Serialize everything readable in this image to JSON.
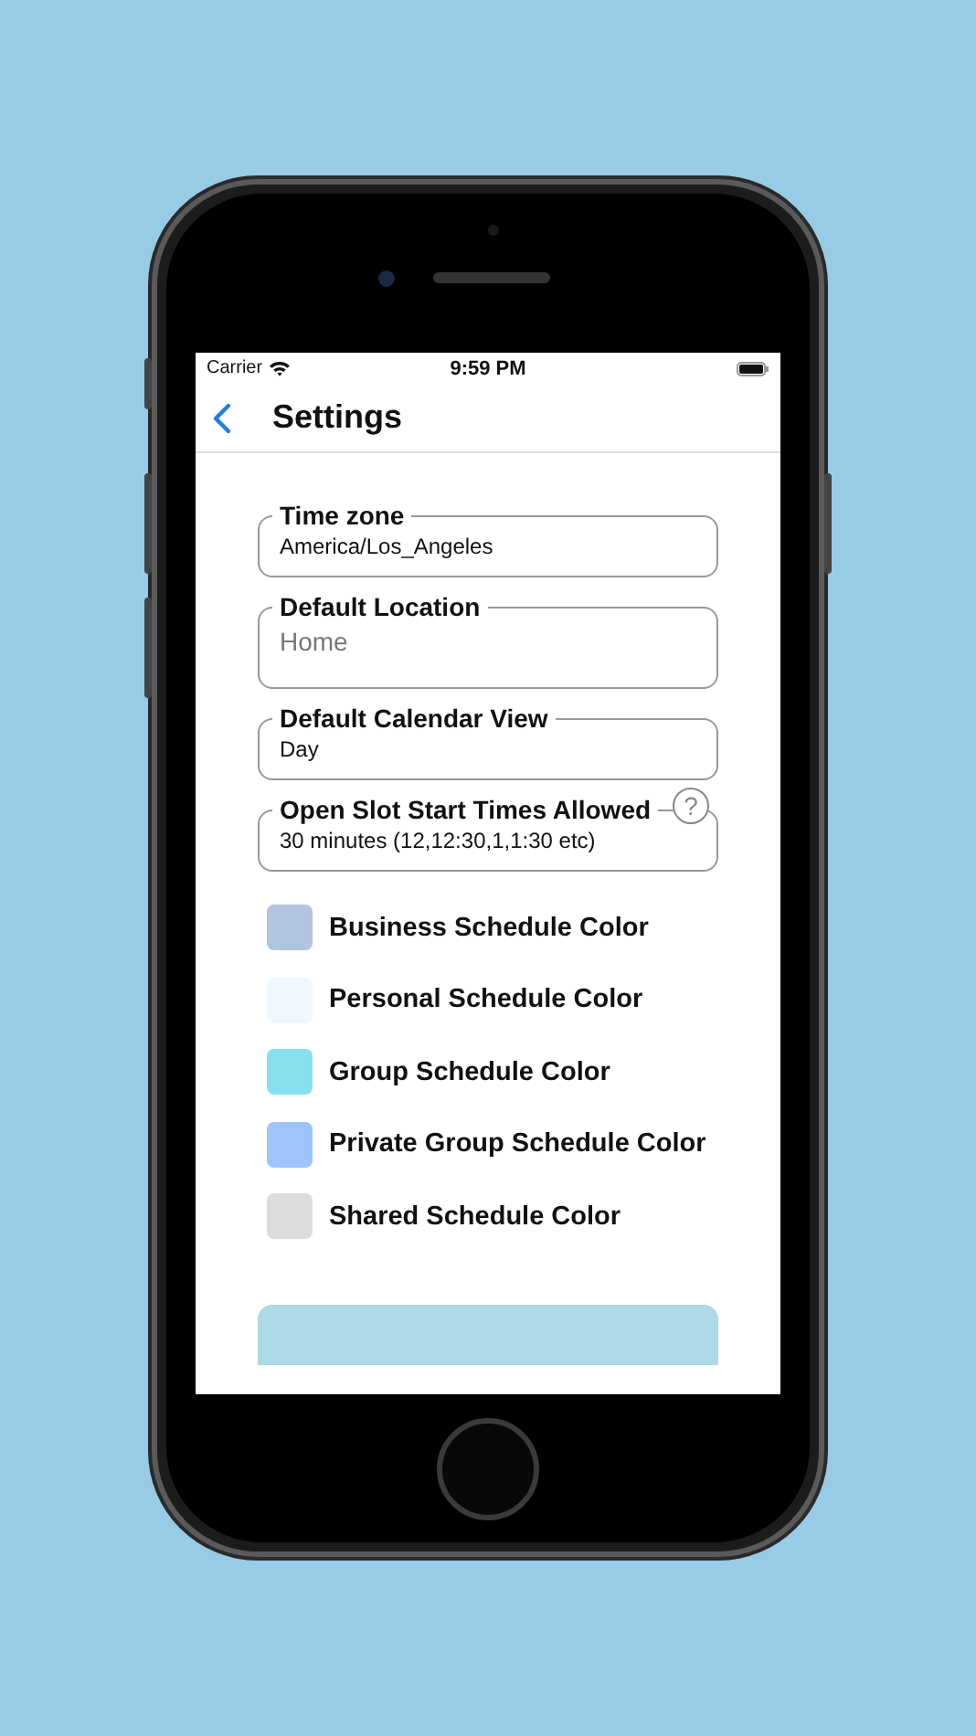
{
  "status_bar": {
    "carrier": "Carrier",
    "time": "9:59 PM"
  },
  "nav": {
    "title": "Settings"
  },
  "fields": [
    {
      "label": "Time zone",
      "value": "America/Los_Angeles"
    },
    {
      "label": "Default Location",
      "placeholder": "Home"
    },
    {
      "label": "Default Calendar View",
      "value": "Day"
    },
    {
      "label": "Open Slot Start Times Allowed",
      "value": "30 minutes (12,12:30,1,1:30 etc)",
      "help": "?"
    }
  ],
  "colors": [
    {
      "label": "Business Schedule Color",
      "color": "#b0c4de"
    },
    {
      "label": "Personal Schedule Color",
      "color": "#f0f8ff"
    },
    {
      "label": "Group Schedule Color",
      "color": "#88dfee"
    },
    {
      "label": "Private Group Schedule Color",
      "color": "#9dc4fb"
    },
    {
      "label": "Shared Schedule Color",
      "color": "#dcdcdc"
    }
  ],
  "update_button": {
    "disabled": true
  }
}
